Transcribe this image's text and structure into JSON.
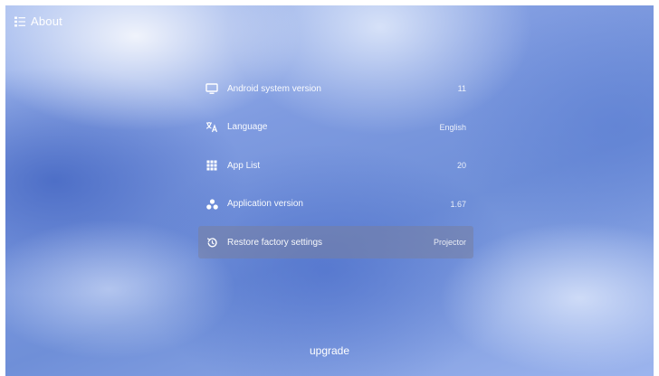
{
  "header": {
    "title": "About",
    "icon": "menu-list-icon"
  },
  "settings": {
    "items": [
      {
        "label": "Android system version",
        "value": "11",
        "icon": "monitor-icon"
      },
      {
        "label": "Language",
        "value": "English",
        "icon": "translate-icon"
      },
      {
        "label": "App List",
        "value": "20",
        "icon": "grid-icon"
      },
      {
        "label": "Application version",
        "value": "1.67",
        "icon": "nodes-icon"
      },
      {
        "label": "Restore factory settings",
        "value": "Projector",
        "icon": "restore-icon",
        "selected": true
      }
    ]
  },
  "footer": {
    "upgrade_label": "upgrade"
  },
  "colors": {
    "text": "#ffffff",
    "selected_row": "#7880a0"
  }
}
